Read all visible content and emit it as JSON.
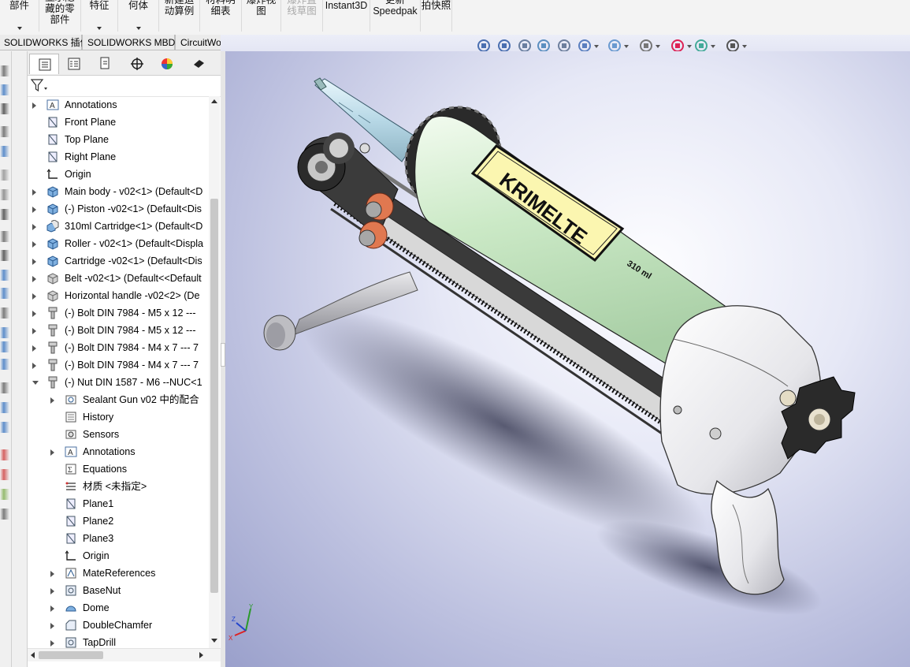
{
  "ribbon": {
    "buttons": [
      {
        "label": "部件",
        "has_arrow": true
      },
      {
        "label": "显示隐\n藏的零\n部件",
        "has_arrow": false
      },
      {
        "label": "特征",
        "has_arrow": true
      },
      {
        "label": "何体",
        "has_arrow": true
      },
      {
        "label": "新建运\n动算例",
        "has_arrow": false
      },
      {
        "label": "材料明\n细表",
        "has_arrow": false
      },
      {
        "label": "爆炸视\n图",
        "has_arrow": false
      },
      {
        "label": "爆炸直\n线草图",
        "has_arrow": false,
        "disabled": true
      },
      {
        "label": "Instant3D",
        "has_arrow": false
      },
      {
        "label": "更新\nSpeedpak",
        "has_arrow": false
      },
      {
        "label": "拍快照",
        "has_arrow": false
      }
    ]
  },
  "tabs": [
    "SOLIDWORKS 插件",
    "SOLIDWORKS MBD",
    "CircuitWorks"
  ],
  "heads_up_toolbar": [
    "zoom-to-fit-icon",
    "zoom-area-icon",
    "previous-view-icon",
    "section-view-icon",
    "dynamic-annotation-icon",
    "view-orientation-icon",
    "display-style-icon",
    "hide-show-icon",
    "edit-appearance-icon",
    "apply-scene-icon",
    "view-settings-icon"
  ],
  "feature_tree": {
    "tabs": [
      "feature-manager-icon",
      "property-manager-icon",
      "configuration-manager-icon",
      "dimxpert-icon",
      "display-manager-icon",
      "cam-icon"
    ],
    "items": [
      {
        "label": "Annotations",
        "icon": "annotations-icon",
        "level": 0,
        "expand": "collapsed"
      },
      {
        "label": "Front Plane",
        "icon": "plane-icon",
        "level": 0,
        "expand": "none"
      },
      {
        "label": "Top Plane",
        "icon": "plane-icon",
        "level": 0,
        "expand": "none"
      },
      {
        "label": "Right Plane",
        "icon": "plane-icon",
        "level": 0,
        "expand": "none"
      },
      {
        "label": "Origin",
        "icon": "origin-icon",
        "level": 0,
        "expand": "none"
      },
      {
        "label": "Main body - v02<1> (Default<D",
        "icon": "part-icon",
        "level": 0,
        "expand": "collapsed"
      },
      {
        "label": "(-) Piston -v02<1> (Default<Dis",
        "icon": "part-icon",
        "level": 0,
        "expand": "collapsed"
      },
      {
        "label": "310ml Cartridge<1> (Default<D",
        "icon": "subassembly-icon",
        "level": 0,
        "expand": "collapsed"
      },
      {
        "label": "Roller - v02<1> (Default<Displa",
        "icon": "part-icon",
        "level": 0,
        "expand": "collapsed"
      },
      {
        "label": "Cartridge -v02<1> (Default<Dis",
        "icon": "part-icon",
        "level": 0,
        "expand": "collapsed"
      },
      {
        "label": "Belt -v02<1> (Default<<Default",
        "icon": "part-grey-icon",
        "level": 0,
        "expand": "collapsed"
      },
      {
        "label": "Horizontal handle -v02<2> (De",
        "icon": "part-grey-icon",
        "level": 0,
        "expand": "collapsed"
      },
      {
        "label": "(-) Bolt DIN 7984 - M5 x 12 ---",
        "icon": "bolt-icon",
        "level": 0,
        "expand": "collapsed"
      },
      {
        "label": "(-) Bolt DIN 7984 - M5 x 12 ---",
        "icon": "bolt-icon",
        "level": 0,
        "expand": "collapsed"
      },
      {
        "label": "(-) Bolt DIN 7984 - M4 x 7 --- 7",
        "icon": "bolt-icon",
        "level": 0,
        "expand": "collapsed"
      },
      {
        "label": "(-) Bolt DIN 7984 - M4 x 7 --- 7",
        "icon": "bolt-icon",
        "level": 0,
        "expand": "collapsed"
      },
      {
        "label": "(-) Nut DIN 1587 - M6 --NUC<1",
        "icon": "bolt-icon",
        "level": 0,
        "expand": "expanded"
      },
      {
        "label": "Sealant Gun v02 中的配合",
        "icon": "mates-icon",
        "level": 1,
        "expand": "collapsed"
      },
      {
        "label": "History",
        "icon": "history-icon",
        "level": 1,
        "expand": "none"
      },
      {
        "label": "Sensors",
        "icon": "sensors-icon",
        "level": 1,
        "expand": "none"
      },
      {
        "label": "Annotations",
        "icon": "annotations-icon",
        "level": 1,
        "expand": "collapsed"
      },
      {
        "label": "Equations",
        "icon": "equations-icon",
        "level": 1,
        "expand": "none"
      },
      {
        "label": "材质 <未指定>",
        "icon": "material-icon",
        "level": 1,
        "expand": "none"
      },
      {
        "label": "Plane1",
        "icon": "plane-icon",
        "level": 1,
        "expand": "none"
      },
      {
        "label": "Plane2",
        "icon": "plane-icon",
        "level": 1,
        "expand": "none"
      },
      {
        "label": "Plane3",
        "icon": "plane-icon",
        "level": 1,
        "expand": "none"
      },
      {
        "label": "Origin",
        "icon": "origin-icon",
        "level": 1,
        "expand": "none"
      },
      {
        "label": "MateReferences",
        "icon": "mate-references-icon",
        "level": 1,
        "expand": "collapsed"
      },
      {
        "label": "BaseNut",
        "icon": "feature-icon",
        "level": 1,
        "expand": "collapsed"
      },
      {
        "label": "Dome",
        "icon": "dome-icon",
        "level": 1,
        "expand": "collapsed"
      },
      {
        "label": "DoubleChamfer",
        "icon": "chamfer-icon",
        "level": 1,
        "expand": "collapsed"
      },
      {
        "label": "TapDrill",
        "icon": "feature-icon",
        "level": 1,
        "expand": "collapsed"
      }
    ]
  },
  "viewport": {
    "label_text": "KRIMELTE",
    "volume_text": "310 ml",
    "triad_axes": [
      "X",
      "Y",
      "Z"
    ]
  },
  "colors": {
    "background_center": "#fdfdff",
    "background_edge": "#9aa0cb",
    "cartridge": "#cbe9c6",
    "label": "#fbf6b0",
    "accent_orange": "#e07850"
  }
}
